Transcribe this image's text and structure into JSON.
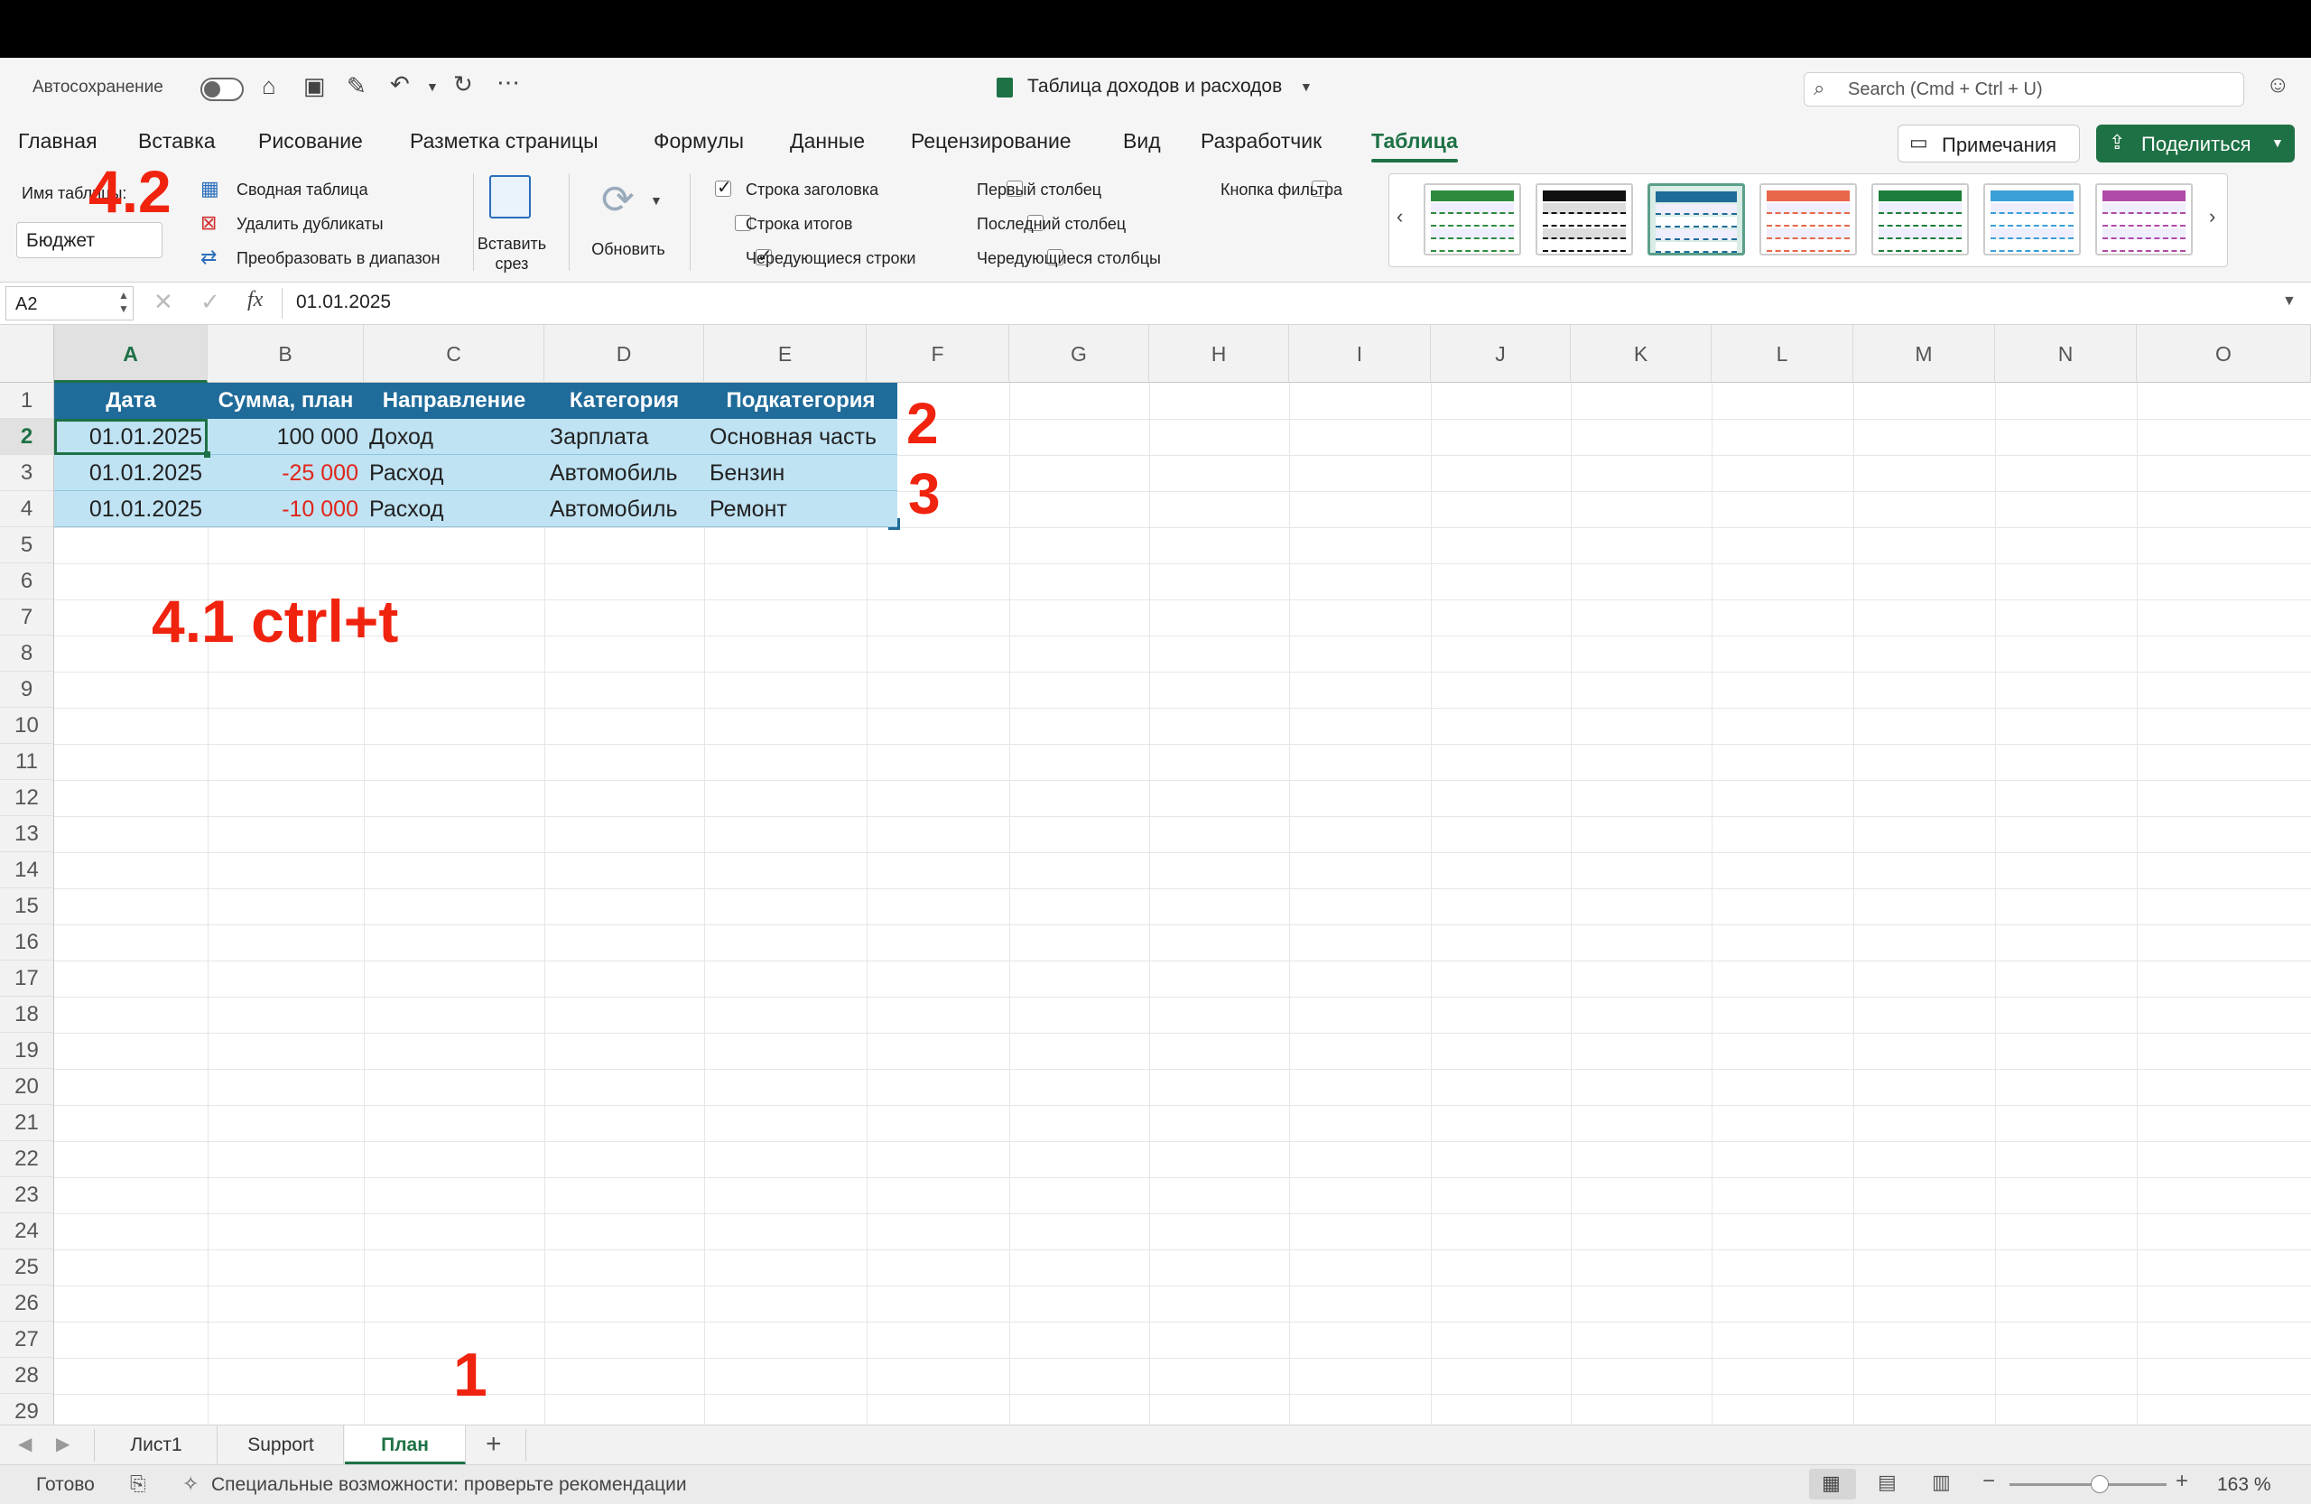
{
  "titlebar": {
    "autosave_label": "Автосохранение",
    "doc_title": "Таблица доходов и расходов",
    "search_placeholder": "Search (Cmd + Ctrl + U)"
  },
  "tabs": [
    "Главная",
    "Вставка",
    "Рисование",
    "Разметка страницы",
    "Формулы",
    "Данные",
    "Рецензирование",
    "Вид",
    "Разработчик",
    "Таблица"
  ],
  "active_tab": "Таблица",
  "buttons": {
    "comments": "Примечания",
    "share": "Поделиться"
  },
  "ribbon": {
    "table_name_label": "Имя таблицы:",
    "table_name_value": "Бюджет",
    "pivot": "Сводная таблица",
    "remove_dupes": "Удалить дубликаты",
    "convert_range": "Преобразовать в диапазон",
    "insert_slicer_1": "Вставить",
    "insert_slicer_2": "срез",
    "refresh": "Обновить",
    "options": {
      "header_row": "Строка заголовка",
      "total_row": "Строка итогов",
      "banded_rows": "Чередующиеся строки",
      "first_column": "Первый столбец",
      "last_column": "Последний столбец",
      "banded_columns": "Чередующиеся столбцы",
      "filter_button": "Кнопка фильтра"
    },
    "style_colors": [
      "#2e8b3d",
      "#111111",
      "#1f6b9a",
      "#e8674a",
      "#1e7d3a",
      "#3a9fd8",
      "#b04aa8"
    ]
  },
  "formula": {
    "cell_ref": "A2",
    "fx": "fx",
    "value": "01.01.2025"
  },
  "columns": [
    "A",
    "B",
    "C",
    "D",
    "E",
    "F",
    "G",
    "H",
    "I",
    "J",
    "K",
    "L",
    "M",
    "N",
    "O"
  ],
  "rows": [
    "1",
    "2",
    "3",
    "4",
    "5",
    "6",
    "7",
    "8",
    "9",
    "10",
    "11",
    "12",
    "13",
    "14",
    "15",
    "16",
    "17",
    "18",
    "19",
    "20",
    "21",
    "22",
    "23",
    "24",
    "25",
    "26",
    "27",
    "28",
    "29"
  ],
  "table": {
    "headers": [
      "Дата",
      "Сумма, план",
      "Направление",
      "Категория",
      "Подкатегория"
    ],
    "data": [
      [
        "01.01.2025",
        "100 000",
        "Доход",
        "Зарплата",
        "Основная часть"
      ],
      [
        "01.01.2025",
        "-25 000",
        "Расход",
        "Автомобиль",
        "Бензин"
      ],
      [
        "01.01.2025",
        "-10 000",
        "Расход",
        "Автомобиль",
        "Ремонт"
      ]
    ]
  },
  "annotations": {
    "a1": "1",
    "a2": "2",
    "a3": "3",
    "a41": "4.1 ctrl+t",
    "a42": "4.2"
  },
  "sheets": [
    "Лист1",
    "Support",
    "План"
  ],
  "active_sheet": "План",
  "status": {
    "ready": "Готово",
    "accessibility": "Специальные возможности: проверьте рекомендации",
    "zoom": "163 %"
  }
}
